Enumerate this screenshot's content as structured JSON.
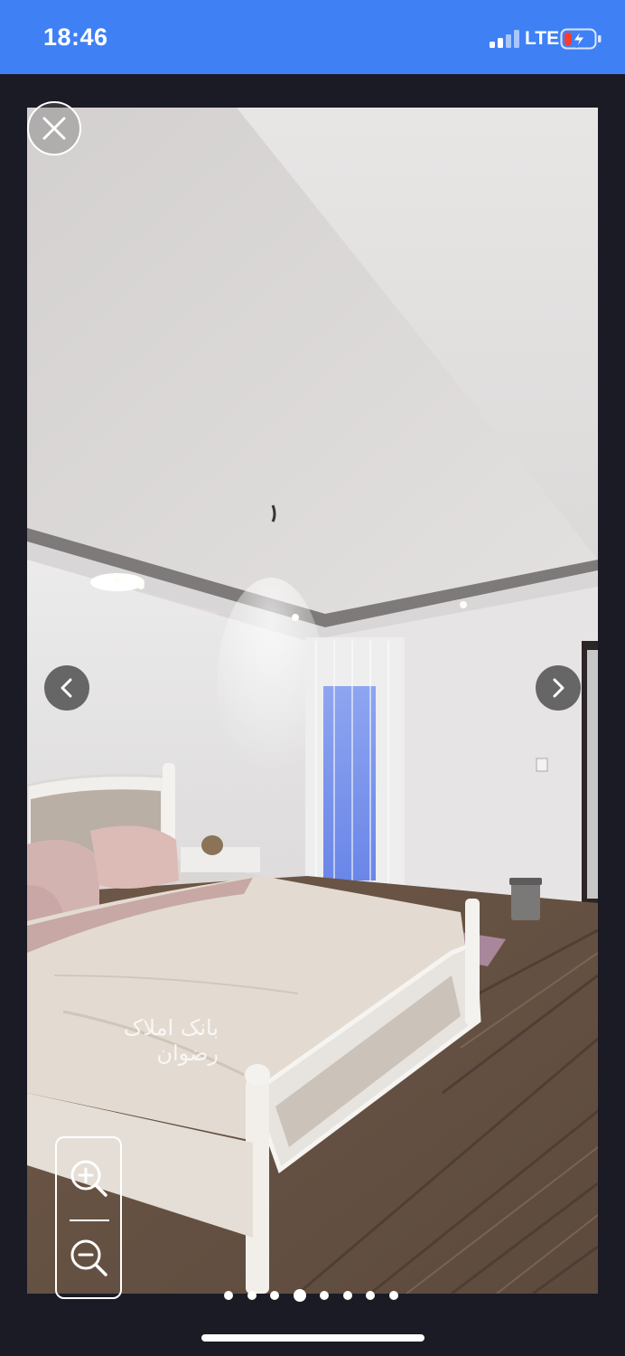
{
  "status_bar": {
    "time": "18:46",
    "network": "LTE",
    "battery_color": "#ff3b30"
  },
  "viewer": {
    "watermark": "بانک املاک رضوان",
    "close_icon": "close-icon",
    "prev_icon": "chevron-left-icon",
    "next_icon": "chevron-right-icon",
    "zoom_in_icon": "zoom-in-icon",
    "zoom_out_icon": "zoom-out-icon",
    "pagination": {
      "total": 8,
      "current": 4
    }
  },
  "colors": {
    "status_bar_bg": "#3f80f5",
    "viewer_bg": "#1b1b26"
  }
}
